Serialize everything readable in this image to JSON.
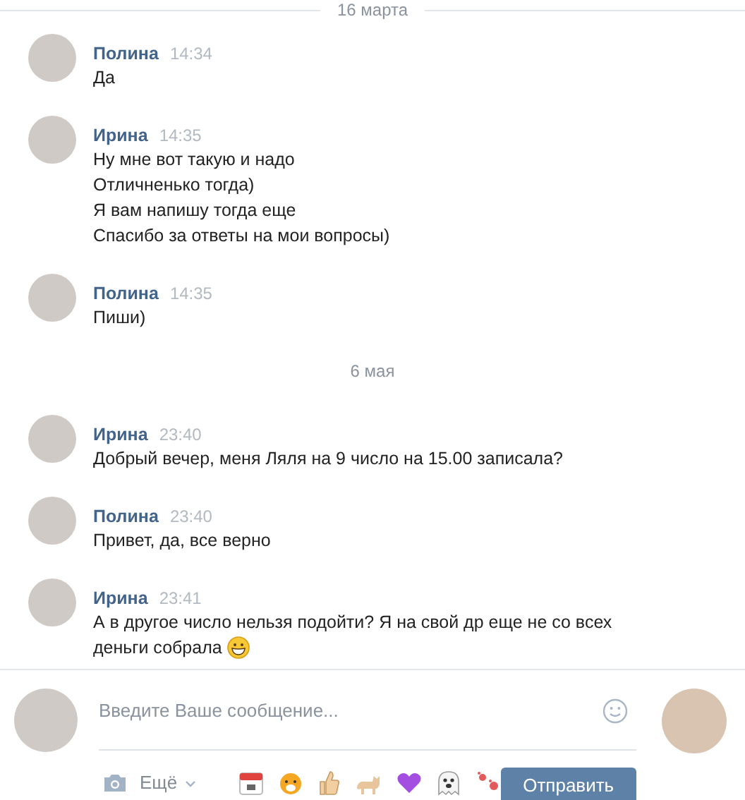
{
  "top_date": "16 марта",
  "messages": [
    {
      "kind": "message",
      "author": "Полина",
      "time": "14:34",
      "lines": [
        "Да"
      ]
    },
    {
      "kind": "message",
      "author": "Ирина",
      "time": "14:35",
      "lines": [
        "Ну мне вот такую и надо",
        "Отличненько тогда)",
        "Я вам напишу тогда еще",
        "Спасибо за ответы на мои вопросы)"
      ]
    },
    {
      "kind": "message",
      "author": "Полина",
      "time": "14:35",
      "lines": [
        "Пиши)"
      ]
    },
    {
      "kind": "date",
      "label": "6 мая"
    },
    {
      "kind": "message",
      "author": "Ирина",
      "time": "23:40",
      "lines": [
        "Добрый вечер, меня Ляля на 9 число на 15.00 записала?"
      ]
    },
    {
      "kind": "message",
      "author": "Полина",
      "time": "23:40",
      "lines": [
        "Привет, да, все верно"
      ]
    },
    {
      "kind": "message",
      "author": "Ирина",
      "time": "23:41",
      "lines": [
        "А в другое число нельзя подойти? Я на свой др еще не со всех",
        "деньги собрала"
      ],
      "emoji": true
    }
  ],
  "composer": {
    "placeholder": "Введите Ваше сообщение...",
    "more_label": "Ещё",
    "send_label": "Отправить"
  }
}
